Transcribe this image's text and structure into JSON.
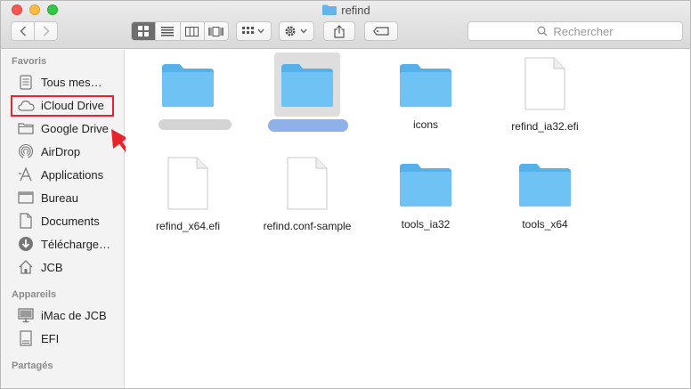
{
  "window": {
    "title": "refind"
  },
  "toolbar": {
    "back_icon": "chevron-left-icon",
    "forward_icon": "chevron-right-icon",
    "views": [
      "icon-view",
      "list-view",
      "column-view",
      "cover-flow-view"
    ],
    "active_view": "icon-view",
    "search_placeholder": "Rechercher"
  },
  "sidebar": {
    "favorites_header": "Favoris",
    "favorites": [
      {
        "label": "Tous mes…",
        "icon": "all-files-icon"
      },
      {
        "label": "iCloud Drive",
        "icon": "cloud-icon"
      },
      {
        "label": "Google Drive",
        "icon": "folder-icon"
      },
      {
        "label": "AirDrop",
        "icon": "airdrop-icon"
      },
      {
        "label": "Applications",
        "icon": "applications-icon"
      },
      {
        "label": "Bureau",
        "icon": "desktop-icon"
      },
      {
        "label": "Documents",
        "icon": "documents-icon"
      },
      {
        "label": "Télécharge…",
        "icon": "download-icon"
      },
      {
        "label": "JCB",
        "icon": "home-icon"
      }
    ],
    "devices_header": "Appareils",
    "devices": [
      {
        "label": "iMac de JCB",
        "icon": "imac-icon"
      },
      {
        "label": "EFI",
        "icon": "drive-icon"
      }
    ],
    "shared_header": "Partagés"
  },
  "files": [
    {
      "name": "",
      "type": "folder",
      "blurred": true
    },
    {
      "name": "",
      "type": "folder",
      "blurred": true,
      "selected": true
    },
    {
      "name": "icons",
      "type": "folder"
    },
    {
      "name": "refind_ia32.efi",
      "type": "document"
    },
    {
      "name": "refind_x64.efi",
      "type": "document"
    },
    {
      "name": "refind.conf-sample",
      "type": "document"
    },
    {
      "name": "tools_ia32",
      "type": "folder"
    },
    {
      "name": "tools_x64",
      "type": "folder"
    }
  ],
  "colors": {
    "folder": "#5bbcf0",
    "highlight": "#e8232a",
    "selected_view": "#6e6e6e"
  }
}
